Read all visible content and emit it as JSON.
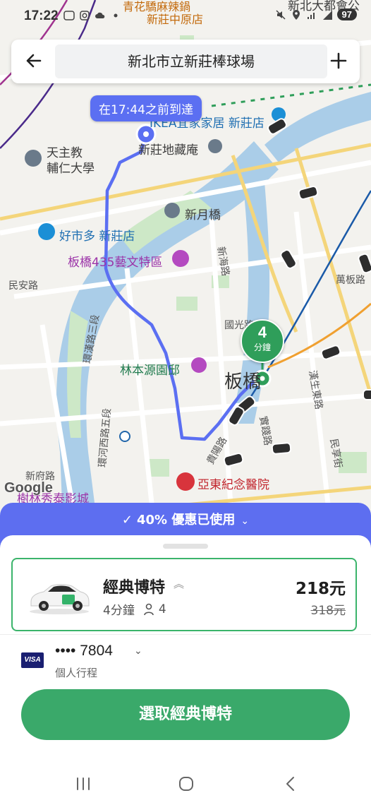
{
  "status_bar": {
    "time": "17:22",
    "left_icons": [
      "line-icon",
      "instagram-icon",
      "cloud-icon",
      "dot-icon"
    ],
    "right_icons": [
      "mute-icon",
      "location-icon",
      "wifi-4g-icon",
      "signal-icon"
    ],
    "battery": "97"
  },
  "search": {
    "destination": "新北市立新莊棒球場",
    "back_icon": "arrow-left-icon",
    "add_icon": "plus-icon"
  },
  "map": {
    "eta_bubble": "在17:44之前到達",
    "pickup_minutes": "4",
    "pickup_unit": "分鐘",
    "labels": {
      "top_restaurant": "青花驕麻辣鍋",
      "top_restaurant_branch": "新莊中原店",
      "top_right_partial": "新北大都會公",
      "ikea": "IKEA宜家家居 新莊店",
      "dizang": "新莊地藏庵",
      "fujen": "天主教\n輔仁大學",
      "xinyue_bridge": "新月橋",
      "costco": "好市多 新莊店",
      "banqiao_435": "板橋435藝文特區",
      "linben": "林本源園邸",
      "banqiao_station": "板橋",
      "far_eastern": "亞東紀念醫院",
      "tianshan_partial": "樹林秀泰影城",
      "minan_road": "民安路",
      "huanhe_road_3": "環漢路三段",
      "huanhe_west_5": "環河西路五段",
      "guoguang_road": "國光路",
      "xinhai_road": "新海路",
      "wanban_road": "萬板路",
      "hanshen_east_road": "漢生東路",
      "guanghua_road": "光路",
      "minxiang_street": "民享街",
      "xinfu_road": "新府路",
      "guiyang_road": "貴陽路",
      "shijian_road": "實踐路",
      "minquan_road": "民權路"
    }
  },
  "google_logo": "Google",
  "promo": {
    "check_icon": "check-icon",
    "text": "40% 優惠已使用",
    "chevron_icon": "chevron-down-icon"
  },
  "ride_option": {
    "name": "經典博特",
    "eta": "4分鐘",
    "capacity": "4",
    "price": "218元",
    "original_price": "318元",
    "car_icon": "car-icon"
  },
  "payment": {
    "card_brand": "VISA",
    "card_number": "•••• 7804",
    "trip_type": "個人行程"
  },
  "confirm_button": "選取經典博特",
  "nav_bar": {
    "recents_icon": "recents-icon",
    "home_icon": "home-icon",
    "back_icon": "back-icon"
  },
  "colors": {
    "accent_green": "#3aa96a",
    "promo_purple": "#5d6ef0",
    "route_blue": "#5b6ff2"
  }
}
